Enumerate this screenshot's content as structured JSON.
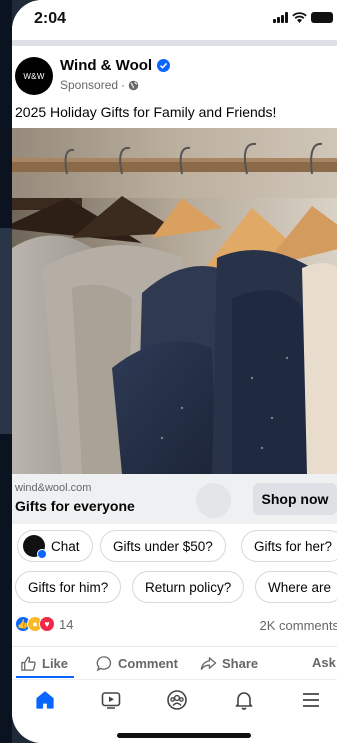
{
  "status_bar": {
    "time": "2:04"
  },
  "post": {
    "page_name": "Wind & Wool",
    "avatar_text": "W&W",
    "sponsored_label": "Sponsored",
    "caption": "2025 Holiday Gifts for Family and Friends!",
    "image_icon": "hanging-sweaters-photo"
  },
  "cta": {
    "url": "wind&wool.com",
    "headline": "Gifts for everyone",
    "button_label": "Shop now"
  },
  "chips": {
    "chat": "Chat",
    "gifts_under_50": "Gifts under $50?",
    "gifts_for_her": "Gifts for her?",
    "gifts_for_him": "Gifts for him?",
    "return_policy": "Return policy?",
    "where_are": "Where are"
  },
  "engagement": {
    "reaction_count": "14",
    "comments": "2K comments"
  },
  "actions": {
    "like": "Like",
    "comment": "Comment",
    "share": "Share",
    "ask": "Ask"
  },
  "tabs": [
    "home-icon",
    "video-icon",
    "groups-icon",
    "notifications-icon",
    "menu-icon"
  ],
  "colors": {
    "accent": "#0866ff",
    "secondary_text": "#65676b",
    "cta_bg": "#eef0f2"
  }
}
